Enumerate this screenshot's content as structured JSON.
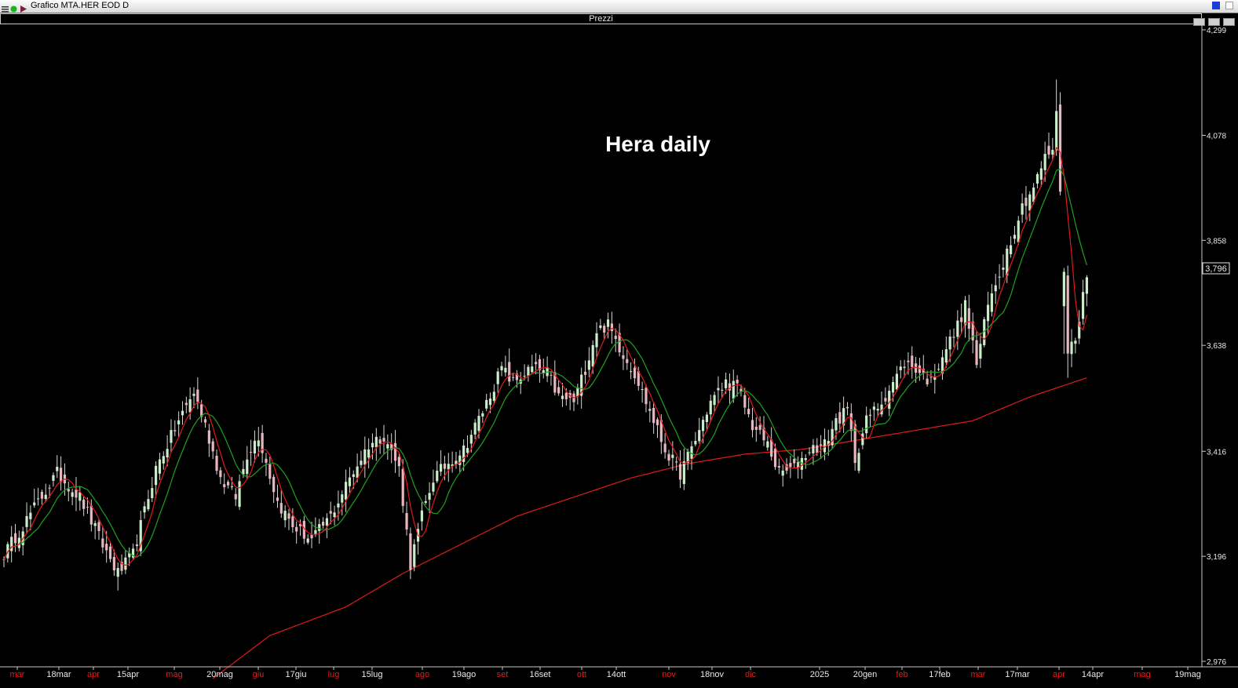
{
  "window": {
    "title": "Grafico MTA.HER EOD D",
    "panel_title": "Prezzi"
  },
  "colors": {
    "background": "#000000",
    "bull_candle": "#c9ecc9",
    "bear_candle": "#e8b6be",
    "wick": "#d8d8d8",
    "ma_fast": "#1fa21f",
    "ma_slow": "#e01b1b",
    "ma_long": "#e01b1b",
    "month_label": "#e01b1b",
    "date_label": "#e8e8e8"
  },
  "chart_data": {
    "type": "candlestick",
    "title": "Hera daily",
    "ylim": [
      2.976,
      4.299
    ],
    "y_ticks": [
      "4,299",
      "4,078",
      "3,858",
      "3,638",
      "3,416",
      "3,196",
      "2,976"
    ],
    "last_price_label": "3,796",
    "x_labels": [
      {
        "text": "mar",
        "kind": "month"
      },
      {
        "text": "18mar",
        "kind": "date"
      },
      {
        "text": "apr",
        "kind": "month"
      },
      {
        "text": "15apr",
        "kind": "date"
      },
      {
        "text": "mag",
        "kind": "month"
      },
      {
        "text": "20mag",
        "kind": "date"
      },
      {
        "text": "giu",
        "kind": "month"
      },
      {
        "text": "17giu",
        "kind": "date"
      },
      {
        "text": "lug",
        "kind": "month"
      },
      {
        "text": "15lug",
        "kind": "date"
      },
      {
        "text": "ago",
        "kind": "month"
      },
      {
        "text": "19ago",
        "kind": "date"
      },
      {
        "text": "set",
        "kind": "month"
      },
      {
        "text": "16set",
        "kind": "date"
      },
      {
        "text": "ott",
        "kind": "month"
      },
      {
        "text": "14ott",
        "kind": "date"
      },
      {
        "text": "nov",
        "kind": "month"
      },
      {
        "text": "18nov",
        "kind": "date"
      },
      {
        "text": "dic",
        "kind": "month"
      },
      {
        "text": "2025",
        "kind": "date"
      },
      {
        "text": "20gen",
        "kind": "date"
      },
      {
        "text": "feb",
        "kind": "month"
      },
      {
        "text": "17feb",
        "kind": "date"
      },
      {
        "text": "mar",
        "kind": "month"
      },
      {
        "text": "17mar",
        "kind": "date"
      },
      {
        "text": "apr",
        "kind": "month"
      },
      {
        "text": "14apr",
        "kind": "date"
      },
      {
        "text": "mag",
        "kind": "month"
      },
      {
        "text": "19mag",
        "kind": "date"
      }
    ],
    "close_anchors": [
      [
        0,
        3.2
      ],
      [
        14,
        3.37
      ],
      [
        20,
        3.32
      ],
      [
        26,
        3.22
      ],
      [
        30,
        3.16
      ],
      [
        34,
        3.2
      ],
      [
        40,
        3.38
      ],
      [
        46,
        3.48
      ],
      [
        50,
        3.54
      ],
      [
        53,
        3.47
      ],
      [
        57,
        3.36
      ],
      [
        61,
        3.32
      ],
      [
        64,
        3.41
      ],
      [
        67,
        3.45
      ],
      [
        72,
        3.31
      ],
      [
        76,
        3.26
      ],
      [
        81,
        3.23
      ],
      [
        86,
        3.28
      ],
      [
        91,
        3.36
      ],
      [
        96,
        3.43
      ],
      [
        100,
        3.45
      ],
      [
        104,
        3.38
      ],
      [
        107,
        3.18
      ],
      [
        110,
        3.28
      ],
      [
        113,
        3.36
      ],
      [
        118,
        3.4
      ],
      [
        121,
        3.42
      ],
      [
        126,
        3.5
      ],
      [
        131,
        3.59
      ],
      [
        134,
        3.56
      ],
      [
        139,
        3.59
      ],
      [
        143,
        3.58
      ],
      [
        146,
        3.53
      ],
      [
        150,
        3.52
      ],
      [
        153,
        3.59
      ],
      [
        156,
        3.67
      ],
      [
        159,
        3.68
      ],
      [
        163,
        3.62
      ],
      [
        166,
        3.58
      ],
      [
        171,
        3.48
      ],
      [
        174,
        3.42
      ],
      [
        178,
        3.37
      ],
      [
        182,
        3.44
      ],
      [
        186,
        3.52
      ],
      [
        190,
        3.56
      ],
      [
        193,
        3.55
      ],
      [
        197,
        3.47
      ],
      [
        201,
        3.43
      ],
      [
        204,
        3.37
      ],
      [
        208,
        3.38
      ],
      [
        212,
        3.42
      ],
      [
        216,
        3.43
      ],
      [
        219,
        3.48
      ],
      [
        222,
        3.5
      ],
      [
        224,
        3.4
      ],
      [
        227,
        3.48
      ],
      [
        231,
        3.52
      ],
      [
        234,
        3.56
      ],
      [
        237,
        3.6
      ],
      [
        240,
        3.59
      ],
      [
        244,
        3.56
      ],
      [
        247,
        3.62
      ],
      [
        250,
        3.66
      ],
      [
        253,
        3.72
      ],
      [
        256,
        3.6
      ],
      [
        259,
        3.72
      ],
      [
        262,
        3.79
      ],
      [
        265,
        3.86
      ],
      [
        268,
        3.93
      ],
      [
        271,
        3.97
      ],
      [
        274,
        4.03
      ],
      [
        276,
        4.05
      ],
      [
        277,
        4.12
      ],
      [
        278,
        3.98
      ],
      [
        280,
        3.62
      ],
      [
        282,
        3.66
      ],
      [
        283,
        3.7
      ],
      [
        285,
        3.78
      ]
    ],
    "ma_fast_period": 10,
    "ma_slow_period": 5,
    "ma_long_period": 200,
    "ma_long_anchors": [
      [
        55,
        2.94
      ],
      [
        70,
        3.03
      ],
      [
        90,
        3.09
      ],
      [
        105,
        3.16
      ],
      [
        120,
        3.22
      ],
      [
        135,
        3.28
      ],
      [
        150,
        3.32
      ],
      [
        165,
        3.36
      ],
      [
        180,
        3.39
      ],
      [
        195,
        3.41
      ],
      [
        210,
        3.42
      ],
      [
        225,
        3.44
      ],
      [
        240,
        3.46
      ],
      [
        255,
        3.48
      ],
      [
        270,
        3.53
      ],
      [
        285,
        3.57
      ]
    ]
  }
}
